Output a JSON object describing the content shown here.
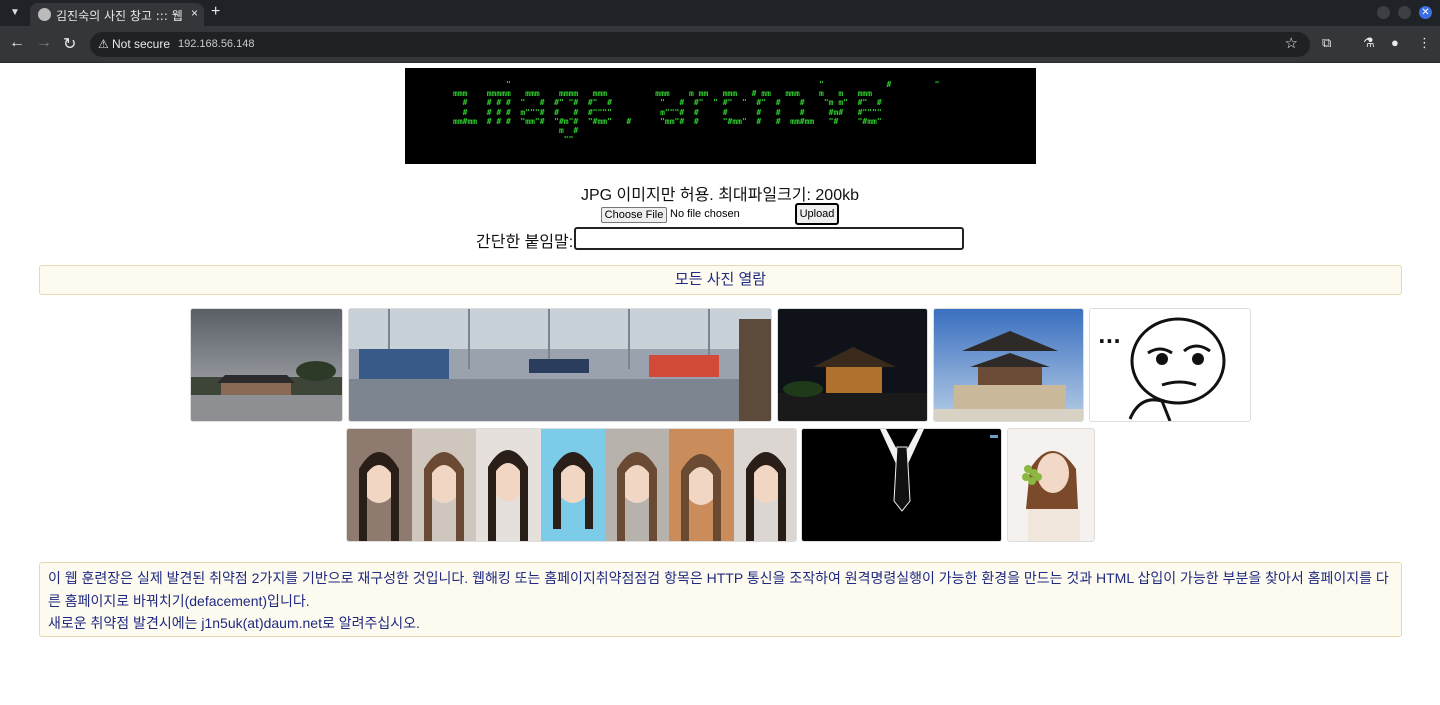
{
  "browser": {
    "tab_title": "김진숙의 사진 창고 ::: 웹해킹 훈련장",
    "tab_close": "×",
    "new_tab": "+",
    "security_label": "Not secure",
    "url": "192.168.56.148"
  },
  "banner": {
    "ascii_lines": [
      "           \"                                                                \"             #         \"",
      "mmm    mmmmm   mmm    mmmm   mmm          mmm    m mm   mmm   # mm   mmm    m   m   mmm",
      "  #    # # #  \"   #  #\" \"#  #\"  #          \"   #  #\"  \" #\"  \"  #\"  #    #    \"m m\"  #\"  #",
      "  #    # # #  m\"\"\"#  #   #  #\"\"\"\"          m\"\"\"#  #     #      #   #    #     #m#   #\"\"\"\"",
      "mm#mm  # # #  \"mm\"#  \"#m\"#  \"#mm\"   #      \"mm\"#  #     \"#mm\"  #   #  mm#mm   \"#    \"#mm\"",
      "                      m  #",
      "                       \"\""
    ]
  },
  "upload": {
    "notice": "JPG 이미지만 허용. 최대파일크기: 200kb",
    "choose_file_label": "Choose File",
    "file_status": "No file chosen",
    "upload_label": "Upload",
    "caption_label": "간단한 붙임말:",
    "caption_value": ""
  },
  "gallery": {
    "all_photos_label": "모든 사진 열람",
    "face_text": "..."
  },
  "info": {
    "line1": "이 웹 훈련장은 실제 발견된 취약점 2가지를 기반으로 재구성한 것입니다. 웹해킹 또는 홈페이지취약점점검 항목은 HTTP 통신을 조작하여 원격명령실행이 가능한 환경을 만드는 것과 HTML 삽입이 가능한 부분을 찾아서 홈페이지를 다른 홈페이지로 바꿔치기(defacement)입니다.",
    "line2": "새로운 취약점 발견시에는 j1n5uk(at)daum.net로 알려주십시오."
  },
  "colors": {
    "banner_text": "#2ecc2e",
    "panel_bg": "#fdfaf0",
    "panel_text": "#1f2a80"
  }
}
